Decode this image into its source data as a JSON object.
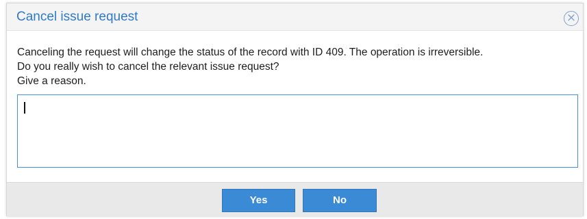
{
  "dialog": {
    "title": "Cancel issue request",
    "close_icon": "circle-x-icon",
    "message_lines": [
      "Canceling the request will change the status of the record with ID 409. The operation is irreversible.",
      "Do you really wish to cancel the relevant issue request?",
      "Give a reason."
    ],
    "reason_value": ""
  },
  "footer": {
    "yes_label": "Yes",
    "no_label": "No"
  },
  "colors": {
    "title": "#2f79c9",
    "button": "#3a8ad6",
    "input_border": "#4a8fd6",
    "footer_bg": "#e9e9e9"
  }
}
